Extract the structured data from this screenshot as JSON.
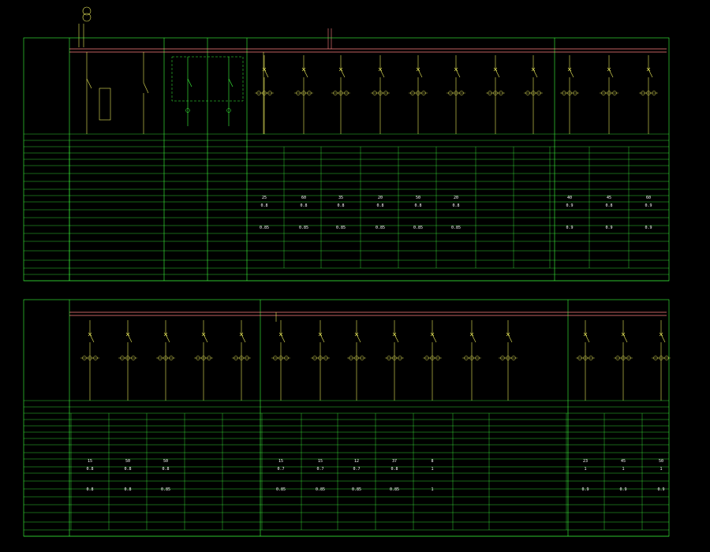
{
  "header": {
    "transformer_lines": [
      "",
      "",
      ""
    ],
    "hv_label": "",
    "bus_label_top": "",
    "cable_label": ""
  },
  "panel1": {
    "left_title": "",
    "side_label": "",
    "bus_tags": [
      "",
      ""
    ],
    "zone_tags": [
      "",
      "",
      "",
      ""
    ],
    "bottom_notes": [
      "",
      "",
      ""
    ],
    "values": {
      "ir": [
        "25",
        "60",
        "35",
        "20",
        "50",
        "20",
        "",
        "",
        "40",
        "45",
        "60"
      ],
      "pf": [
        "0.8",
        "0.8",
        "0.8",
        "0.8",
        "0.8",
        "0.8",
        "",
        "",
        "0.9",
        "0.8",
        "0.9"
      ],
      "kx": [
        "0.85",
        "0.85",
        "0.85",
        "0.85",
        "0.85",
        "0.85",
        "",
        "",
        "0.9",
        "0.9",
        "0.9"
      ]
    }
  },
  "panel2": {
    "left_title": "",
    "bus_tag": "",
    "values": {
      "ir": [
        "15",
        "50",
        "50",
        "",
        "",
        "15",
        "15",
        "12",
        "37",
        "8",
        "",
        "",
        "23",
        "45",
        "50"
      ],
      "pf": [
        "0.8",
        "0.8",
        "0.8",
        "",
        "",
        "0.7",
        "0.7",
        "0.7",
        "0.8",
        "1",
        "",
        "",
        "1",
        "1",
        "1"
      ],
      "kx": [
        "0.8",
        "0.8",
        "0.85",
        "",
        "",
        "0.85",
        "0.85",
        "0.85",
        "0.85",
        "1",
        "",
        "",
        "0.9",
        "0.9",
        "0.9"
      ]
    }
  },
  "footer_note": "",
  "colors": {
    "grid": "#3cff3c",
    "feeder": "#e8e85a",
    "bus": "#ff8080",
    "text": "#d8e84a",
    "background": "#000000"
  }
}
